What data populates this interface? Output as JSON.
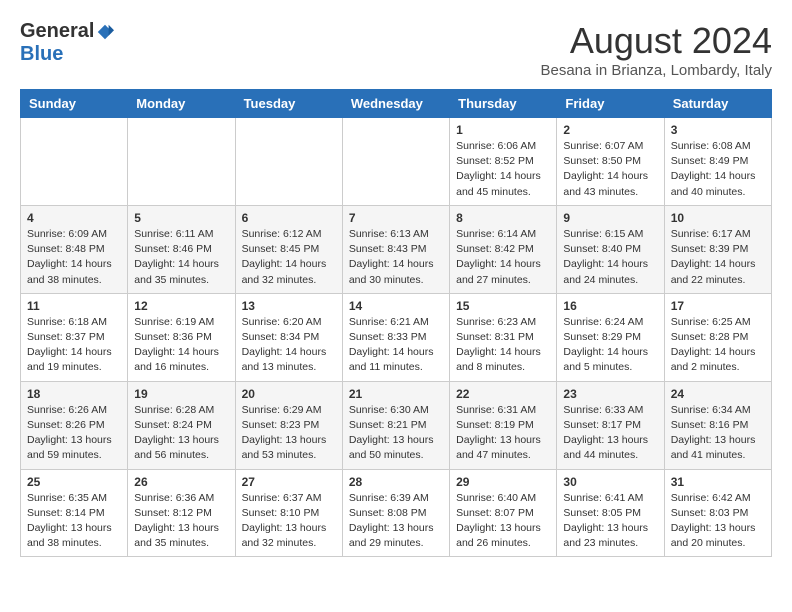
{
  "header": {
    "logo_general": "General",
    "logo_blue": "Blue",
    "title": "August 2024",
    "location": "Besana in Brianza, Lombardy, Italy"
  },
  "weekdays": [
    "Sunday",
    "Monday",
    "Tuesday",
    "Wednesday",
    "Thursday",
    "Friday",
    "Saturday"
  ],
  "weeks": [
    [
      {
        "day": "",
        "info": ""
      },
      {
        "day": "",
        "info": ""
      },
      {
        "day": "",
        "info": ""
      },
      {
        "day": "",
        "info": ""
      },
      {
        "day": "1",
        "info": "Sunrise: 6:06 AM\nSunset: 8:52 PM\nDaylight: 14 hours\nand 45 minutes."
      },
      {
        "day": "2",
        "info": "Sunrise: 6:07 AM\nSunset: 8:50 PM\nDaylight: 14 hours\nand 43 minutes."
      },
      {
        "day": "3",
        "info": "Sunrise: 6:08 AM\nSunset: 8:49 PM\nDaylight: 14 hours\nand 40 minutes."
      }
    ],
    [
      {
        "day": "4",
        "info": "Sunrise: 6:09 AM\nSunset: 8:48 PM\nDaylight: 14 hours\nand 38 minutes."
      },
      {
        "day": "5",
        "info": "Sunrise: 6:11 AM\nSunset: 8:46 PM\nDaylight: 14 hours\nand 35 minutes."
      },
      {
        "day": "6",
        "info": "Sunrise: 6:12 AM\nSunset: 8:45 PM\nDaylight: 14 hours\nand 32 minutes."
      },
      {
        "day": "7",
        "info": "Sunrise: 6:13 AM\nSunset: 8:43 PM\nDaylight: 14 hours\nand 30 minutes."
      },
      {
        "day": "8",
        "info": "Sunrise: 6:14 AM\nSunset: 8:42 PM\nDaylight: 14 hours\nand 27 minutes."
      },
      {
        "day": "9",
        "info": "Sunrise: 6:15 AM\nSunset: 8:40 PM\nDaylight: 14 hours\nand 24 minutes."
      },
      {
        "day": "10",
        "info": "Sunrise: 6:17 AM\nSunset: 8:39 PM\nDaylight: 14 hours\nand 22 minutes."
      }
    ],
    [
      {
        "day": "11",
        "info": "Sunrise: 6:18 AM\nSunset: 8:37 PM\nDaylight: 14 hours\nand 19 minutes."
      },
      {
        "day": "12",
        "info": "Sunrise: 6:19 AM\nSunset: 8:36 PM\nDaylight: 14 hours\nand 16 minutes."
      },
      {
        "day": "13",
        "info": "Sunrise: 6:20 AM\nSunset: 8:34 PM\nDaylight: 14 hours\nand 13 minutes."
      },
      {
        "day": "14",
        "info": "Sunrise: 6:21 AM\nSunset: 8:33 PM\nDaylight: 14 hours\nand 11 minutes."
      },
      {
        "day": "15",
        "info": "Sunrise: 6:23 AM\nSunset: 8:31 PM\nDaylight: 14 hours\nand 8 minutes."
      },
      {
        "day": "16",
        "info": "Sunrise: 6:24 AM\nSunset: 8:29 PM\nDaylight: 14 hours\nand 5 minutes."
      },
      {
        "day": "17",
        "info": "Sunrise: 6:25 AM\nSunset: 8:28 PM\nDaylight: 14 hours\nand 2 minutes."
      }
    ],
    [
      {
        "day": "18",
        "info": "Sunrise: 6:26 AM\nSunset: 8:26 PM\nDaylight: 13 hours\nand 59 minutes."
      },
      {
        "day": "19",
        "info": "Sunrise: 6:28 AM\nSunset: 8:24 PM\nDaylight: 13 hours\nand 56 minutes."
      },
      {
        "day": "20",
        "info": "Sunrise: 6:29 AM\nSunset: 8:23 PM\nDaylight: 13 hours\nand 53 minutes."
      },
      {
        "day": "21",
        "info": "Sunrise: 6:30 AM\nSunset: 8:21 PM\nDaylight: 13 hours\nand 50 minutes."
      },
      {
        "day": "22",
        "info": "Sunrise: 6:31 AM\nSunset: 8:19 PM\nDaylight: 13 hours\nand 47 minutes."
      },
      {
        "day": "23",
        "info": "Sunrise: 6:33 AM\nSunset: 8:17 PM\nDaylight: 13 hours\nand 44 minutes."
      },
      {
        "day": "24",
        "info": "Sunrise: 6:34 AM\nSunset: 8:16 PM\nDaylight: 13 hours\nand 41 minutes."
      }
    ],
    [
      {
        "day": "25",
        "info": "Sunrise: 6:35 AM\nSunset: 8:14 PM\nDaylight: 13 hours\nand 38 minutes."
      },
      {
        "day": "26",
        "info": "Sunrise: 6:36 AM\nSunset: 8:12 PM\nDaylight: 13 hours\nand 35 minutes."
      },
      {
        "day": "27",
        "info": "Sunrise: 6:37 AM\nSunset: 8:10 PM\nDaylight: 13 hours\nand 32 minutes."
      },
      {
        "day": "28",
        "info": "Sunrise: 6:39 AM\nSunset: 8:08 PM\nDaylight: 13 hours\nand 29 minutes."
      },
      {
        "day": "29",
        "info": "Sunrise: 6:40 AM\nSunset: 8:07 PM\nDaylight: 13 hours\nand 26 minutes."
      },
      {
        "day": "30",
        "info": "Sunrise: 6:41 AM\nSunset: 8:05 PM\nDaylight: 13 hours\nand 23 minutes."
      },
      {
        "day": "31",
        "info": "Sunrise: 6:42 AM\nSunset: 8:03 PM\nDaylight: 13 hours\nand 20 minutes."
      }
    ]
  ]
}
